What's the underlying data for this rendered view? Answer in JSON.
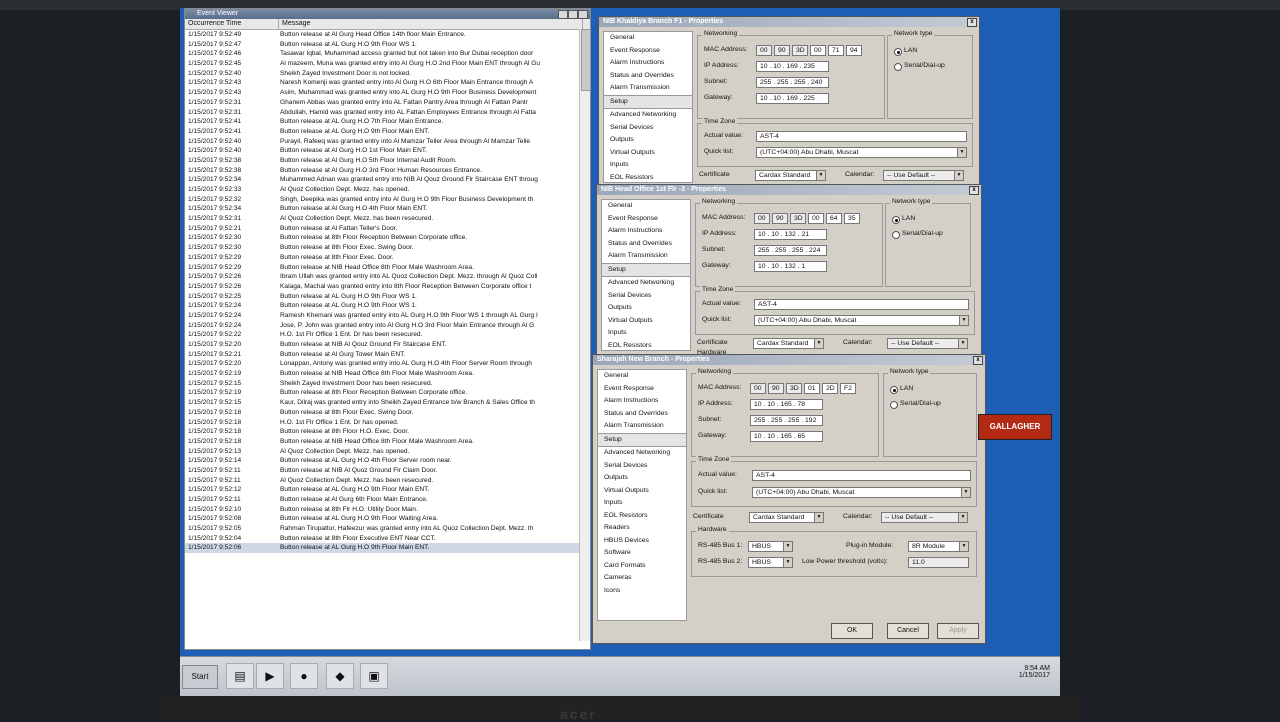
{
  "event_viewer": {
    "title": "Event Viewer",
    "columns": [
      "Occurrence Time",
      "Message"
    ],
    "rows": [
      [
        "1/15/2017 9:52:49",
        "Button release at Al Gurg Head Office 14th floor Main Entrance."
      ],
      [
        "1/15/2017 9:52:47",
        "Button release at AL Gurg H.O 9th Floor WS 1."
      ],
      [
        "1/15/2017 9:52:46",
        "Tasawar Iqbal, Muhammad access granted but not taken into Bur Dubai reception door"
      ],
      [
        "1/15/2017 9:52:45",
        "Al mazeem, Muna was granted entry into Al Gurg H.O 2nd Floor Main ENT through Al Gu"
      ],
      [
        "1/15/2017 9:52:40",
        "Sheikh Zayed Investment Door is not locked."
      ],
      [
        "1/15/2017 9:52:43",
        "Naresh Komenji was granted entry into Al Gurg H.O 6th Floor Main Entrance through A"
      ],
      [
        "1/15/2017 9:52:43",
        "Asim, Muhammad was granted entry into AL Gurg H.O 9th Floor Business Development"
      ],
      [
        "1/15/2017 9:52:31",
        "Ghanem Abbas was granted entry into AL Fattan Pantry Area through Al Fattan Pantr"
      ],
      [
        "1/15/2017 9:52:31",
        "Abdullah, Hamid was granted entry into AL Fattan Employees Entrance through Al Fatta"
      ],
      [
        "1/15/2017 9:52:41",
        "Button release at AL Gurg H.O 7th Floor Main Entrance."
      ],
      [
        "1/15/2017 9:52:41",
        "Button release at AL Gurg H.O 9th Floor Main ENT."
      ],
      [
        "1/15/2017 9:52:40",
        "Purayil, Rafeeq was granted entry into Al Mamzar Teller Area through Al Mamzar Telle"
      ],
      [
        "1/15/2017 9:52:40",
        "Button release at Al Gurg H.O 1st Floor Main ENT."
      ],
      [
        "1/15/2017 9:52:38",
        "Button release at Al Gurg H.O 5th Floor Internal Audit Room."
      ],
      [
        "1/15/2017 9:52:38",
        "Button release at Al Gurg H.O 3rd Floor Human Resources Entrance."
      ],
      [
        "1/15/2017 9:52:34",
        "Muhammed Adnan was granted entry into NIB Al Qouz Ground Flr Staircase ENT throug"
      ],
      [
        "1/15/2017 9:52:33",
        "Al Quoz Collection Dept. Mezz. has opened."
      ],
      [
        "1/15/2017 9:52:32",
        "Singh, Deepika was granted entry into Al Gurg H.O 9th Floor Business Development th"
      ],
      [
        "1/15/2017 9:52:34",
        "Button release at Al Gurg H.O 4th Floor Main ENT."
      ],
      [
        "1/15/2017 9:52:31",
        "Al Quoz Collection Dept. Mezz. has been resecured."
      ],
      [
        "1/15/2017 9:52:21",
        "Button release at Al Fattan Teller's Door."
      ],
      [
        "1/15/2017 9:52:30",
        "Button release at 8th Floor Reception Between Corporate office."
      ],
      [
        "1/15/2017 9:52:30",
        "Button release at 8th Floor Exec. Swing Door."
      ],
      [
        "1/15/2017 9:52:29",
        "Button release at 8th Floor Exec. Door."
      ],
      [
        "1/15/2017 9:52:29",
        "Button release at NIB Head Office 8th Floor Male Washroom Area."
      ],
      [
        "1/15/2017 9:52:26",
        "Ibram Ullah was granted entry into AL Quoz Collection Dept. Mezz. through Al Quoz Coll"
      ],
      [
        "1/15/2017 9:52:26",
        "Kalaga, Machal was granted entry into 8th Floor Reception Between Corporate office t"
      ],
      [
        "1/15/2017 9:52:25",
        "Button release at AL Gurg H.O 9th Floor WS 1."
      ],
      [
        "1/15/2017 9:52:24",
        "Button release at AL Gurg H.O 9th Floor WS 1."
      ],
      [
        "1/15/2017 9:52:24",
        "Ramesh Khemani was granted entry into AL Gurg H.O 9th Floor WS 1 through AL Gurg I"
      ],
      [
        "1/15/2017 9:52:24",
        "Jose, P. John was granted entry into Al Gurg H.O 3rd Floor Main Entrance through Al G"
      ],
      [
        "1/15/2017 9:52:22",
        "H.O. 1st Flr Office 1 Ent. Dr has been resecured."
      ],
      [
        "1/15/2017 9:52:20",
        "Button release at NIB Al Qouz Ground Flr Staircase ENT."
      ],
      [
        "1/15/2017 9:52:21",
        "Button release at Al Gurg Tower Main ENT."
      ],
      [
        "1/15/2017 9:52:20",
        "Lonappan, Antony was granted entry into AL Gurg H.O 4th Floor Server Room through"
      ],
      [
        "1/15/2017 9:52:19",
        "Button release at NIB Head Office 8th Floor Male Washroom Area."
      ],
      [
        "1/15/2017 9:52:15",
        "Sheikh Zayed Investment Door has been resecured."
      ],
      [
        "1/15/2017 9:52:19",
        "Button release at 8th Floor Reception Between Corporate office."
      ],
      [
        "1/15/2017 9:52:15",
        "Kaur, Dilraj was granted entry into Sheikh Zayed Entrance b/w Branch & Sales Office th"
      ],
      [
        "1/15/2017 9:52:18",
        "Button release at 8th Floor Exec. Swing Door."
      ],
      [
        "1/15/2017 9:52:18",
        "H.O. 1st Flr Office 1 Ent. Dr has opened."
      ],
      [
        "1/15/2017 9:52:18",
        "Button release at 8th Floor H.O. Exec. Door."
      ],
      [
        "1/15/2017 9:52:18",
        "Button release at NIB Head Office 8th Floor Male Washroom Area."
      ],
      [
        "1/15/2017 9:52:13",
        "Al Quoz Collection Dept. Mezz. has opened."
      ],
      [
        "1/15/2017 9:52:14",
        "Button release at AL Gurg H.O 4th Floor Server room near."
      ],
      [
        "1/15/2017 9:52:11",
        "Button release at NIB Al Quoz Ground Flr Claim Door."
      ],
      [
        "1/15/2017 9:52:11",
        "Al Quoz Collection Dept. Mezz. has been resecured."
      ],
      [
        "1/15/2017 9:52:12",
        "Button release at AL Gurg H.O 9th Floor Main ENT."
      ],
      [
        "1/15/2017 9:52:11",
        "Button release at Al Gurg 6th Floor Main Entrance."
      ],
      [
        "1/15/2017 9:52:10",
        "Button release at 8th Flr H.O. Utility Door Main."
      ],
      [
        "1/15/2017 9:52:08",
        "Button release at AL Gurg H.O 9th Floor Waiting Area."
      ],
      [
        "1/15/2017 9:52:05",
        "Rahman Tirupattur, Hafeezur was granted entry into AL Quoz Collection Dept. Mezz. th"
      ],
      [
        "1/15/2017 9:52:04",
        "Button release at 8th Floor Executive ENT Near CCT."
      ],
      [
        "1/15/2017 9:52:06",
        "Button release at AL Gurg H.O 9th Floor Main ENT."
      ]
    ]
  },
  "nav_labels": {
    "general": "General",
    "event_response": "Event Response",
    "alarm_instructions": "Alarm Instructions",
    "status_overrides": "Status and Overrides",
    "alarm_transmission": "Alarm Transmission",
    "setup": "Setup",
    "advanced_networking": "Advanced Networking",
    "serial_devices": "Serial Devices",
    "outputs": "Outputs",
    "virtual_outputs": "Virtual Outputs",
    "inputs": "Inputs",
    "eol_resistors": "EOL Resistors",
    "readers": "Readers",
    "hbus_devices": "HBUS Devices",
    "software": "Software",
    "card_formats": "Card Formats",
    "cameras": "Cameras",
    "icons": "Icons"
  },
  "labels": {
    "networking": "Networking",
    "mac_address": "MAC Address:",
    "ip_address": "IP Address:",
    "subnet": "Subnet:",
    "gateway": "Gateway:",
    "network_type": "Network type",
    "lan": "LAN",
    "serial_dialup": "Serial/Dial-up",
    "time_zone": "Time Zone",
    "actual_value": "Actual value:",
    "quick_list": "Quick list:",
    "certificate": "Certificate",
    "calendar": "Calendar:",
    "hardware": "Hardware",
    "rs485_bus1": "RS-485 Bus 1:",
    "rs485_bus2": "RS-485 Bus 2:",
    "plugin_module": "Plug-in Module:",
    "low_power": "Low Power threshold (volts):"
  },
  "dialogs": {
    "d1": {
      "title": "NIB Khaldiya Branch F1 - Properties",
      "mac": [
        "00",
        "90",
        "3D",
        "00",
        "71",
        "94"
      ],
      "ip": "10 . 10 . 169 . 235",
      "subnet": "255 . 255 . 255 . 240",
      "gateway": "10 . 10 . 169 . 225",
      "actual_value": "AST-4",
      "quick_list": "(UTC+04:00) Abu Dhabi, Muscat",
      "certificate": "Cardax Standard",
      "calendar": "-- Use Default --"
    },
    "d2": {
      "title": "NIB Head Office 1st Flr -3 - Properties",
      "mac": [
        "00",
        "90",
        "3D",
        "00",
        "64",
        "35"
      ],
      "ip": "10 . 10 . 132 . 21",
      "subnet": "255 . 255 . 255 . 224",
      "gateway": "10 . 10 . 132 . 1",
      "actual_value": "AST-4",
      "quick_list": "(UTC+04:00) Abu Dhabi, Muscat",
      "certificate": "Cardax Standard",
      "calendar": "-- Use Default --"
    },
    "d3": {
      "title": "Sharajah New Branch - Properties",
      "mac": [
        "00",
        "90",
        "3D",
        "01",
        "2D",
        "F2"
      ],
      "ip": "10 . 10 . 165 . 78",
      "subnet": "255 . 255 . 255 . 192",
      "gateway": "10 . 10 . 165 . 65",
      "actual_value": "AST-4",
      "quick_list": "(UTC+04:00) Abu Dhabi, Muscat",
      "certificate": "Cardax Standard",
      "calendar": "-- Use Default --",
      "bus1": "HBUS",
      "bus2": "HBUS",
      "plugin": "8R Module",
      "low_power": "11.0",
      "ok": "OK",
      "cancel": "Cancel",
      "apply": "Apply"
    }
  },
  "brand": "GALLAGHER",
  "taskbar": {
    "start": "Start",
    "time": "9:54 AM",
    "date": "1/15/2017"
  },
  "monitor_brand": "acer"
}
